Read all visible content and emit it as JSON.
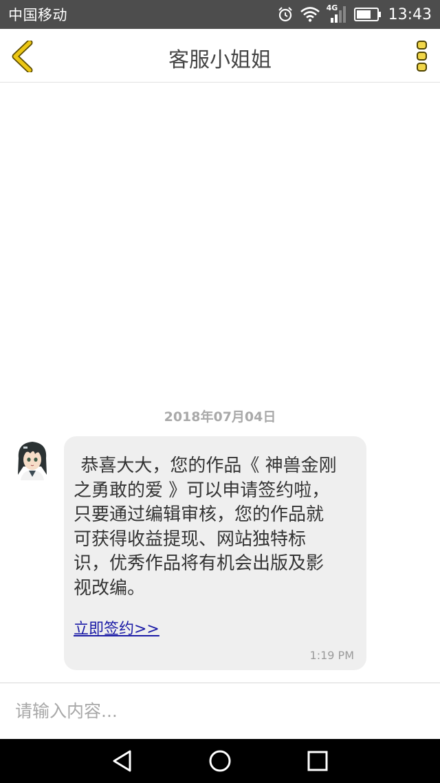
{
  "status_bar": {
    "carrier": "中国移动",
    "network": "4G",
    "time": "13:43"
  },
  "header": {
    "title": "客服小姐姐",
    "back_icon": "chevron-left-icon",
    "more_icon": "more-vertical-icon",
    "accent_color": "#e8c200"
  },
  "chat": {
    "date": "2018年07月04日",
    "message": {
      "text": "恭喜大大，您的作品《 神兽金刚之勇敢的爱 》可以申请签约啦，只要通过编辑审核，您的作品就可获得收益提现、网站独特标识，优秀作品将有机会出版及影视改编。",
      "link": "立即签约>> ",
      "time": "1:19 PM"
    }
  },
  "input": {
    "placeholder": "请输入内容..."
  },
  "nav_bar": {
    "back_icon": "triangle-back-icon",
    "home_icon": "circle-home-icon",
    "recents_icon": "square-recents-icon"
  }
}
